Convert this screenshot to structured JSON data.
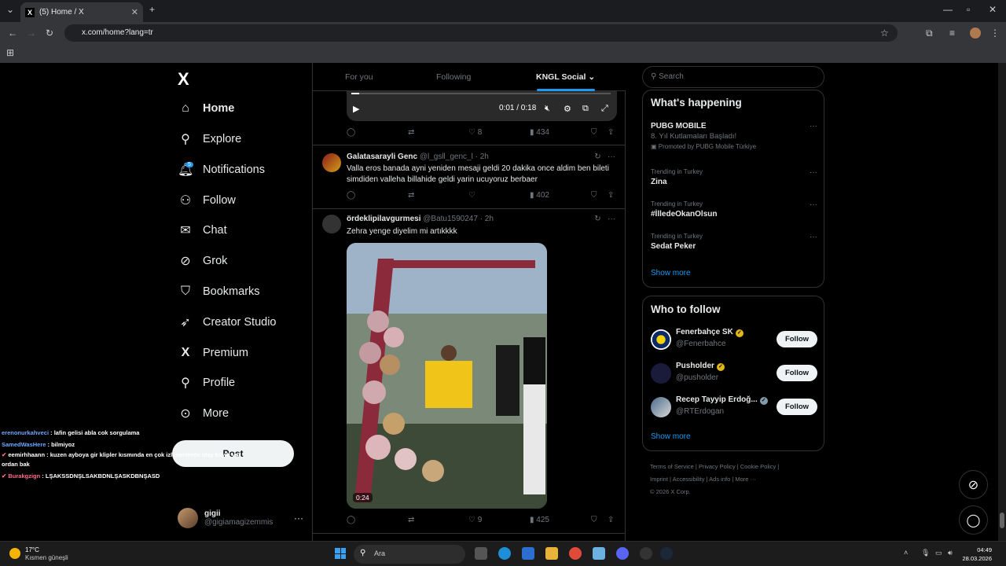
{
  "browser": {
    "tab_title": "(5) Home / X",
    "tab_favicon": "X",
    "url": "x.com/home?lang=tr"
  },
  "nav": {
    "logo": "X",
    "notifications_badge": "5",
    "items": [
      {
        "label": "Home",
        "icon": "home-icon"
      },
      {
        "label": "Explore",
        "icon": "search-icon"
      },
      {
        "label": "Notifications",
        "icon": "bell-icon"
      },
      {
        "label": "Follow",
        "icon": "person-add-icon"
      },
      {
        "label": "Chat",
        "icon": "mail-icon"
      },
      {
        "label": "Grok",
        "icon": "grok-icon"
      },
      {
        "label": "Bookmarks",
        "icon": "bookmark-icon"
      },
      {
        "label": "Creator Studio",
        "icon": "rocket-icon"
      },
      {
        "label": "Premium",
        "icon": "x-icon"
      },
      {
        "label": "Profile",
        "icon": "person-icon"
      },
      {
        "label": "More",
        "icon": "more-circle-icon"
      }
    ],
    "post_label": "Post",
    "account": {
      "name": "gigii",
      "handle": "@gigiamagizemmis"
    }
  },
  "chat_overlay": [
    {
      "user": "erenonurkahveci",
      "text": " : lafin gelisi abla cok sorgulama"
    },
    {
      "user": "SamedWasHere",
      "text": " : bilmiyoz"
    },
    {
      "user": "eemirhhaann",
      "text": " : kuzen ayboya gir klipler kısmında en çok izlenenlerde olay kayıtı var ordan bak"
    },
    {
      "user": "Burakgzign",
      "text": " : LŞAKSSDNŞLSAKBDNLŞASKDBNŞASD"
    }
  ],
  "feed": {
    "tabs": [
      "For you",
      "Following",
      "KNGL Social"
    ],
    "video_time": "0:01 / 0:18",
    "tweet0_actions": {
      "likes": "8",
      "views": "434"
    },
    "tweet1": {
      "name": "Galatasarayli Genc",
      "handle": "@l_gsll_genc_l",
      "time": "· 2h",
      "text": "Valla eros banada ayni yeniden mesaji geldi 20 dakika once aldim ben bileti simdiden valleha billahide geldi yarin ucuyoruz berbaer",
      "views": "402"
    },
    "tweet2": {
      "name": "ördeklipilavgurmesi",
      "handle": "@Batu1590247",
      "time": "· 2h",
      "text": "Zehra yenge diyelim mi artıkkkk",
      "duration": "0:24",
      "likes": "9",
      "views": "425"
    }
  },
  "right": {
    "search_placeholder": "Search",
    "happening_title": "What's happening",
    "trends": [
      {
        "meta": "",
        "title": "PUBG MOBILE",
        "sub": "8. Yıl Kutlamaları Başladı!",
        "promo": "Promoted by PUBG Mobile Türkiye"
      },
      {
        "meta": "Trending in Turkey",
        "title": "Zina"
      },
      {
        "meta": "Trending in Turkey",
        "title": "#İlledeOkanOlsun"
      },
      {
        "meta": "Trending in Turkey",
        "title": "Sedat Peker"
      }
    ],
    "show_more": "Show more",
    "who_title": "Who to follow",
    "who": [
      {
        "name": "Fenerbahçe SK",
        "handle": "@Fenerbahce",
        "btn": "Follow"
      },
      {
        "name": "Pusholder",
        "handle": "@pusholder",
        "btn": "Follow"
      },
      {
        "name": "Recep Tayyip Erdoğ...",
        "handle": "@RTErdogan",
        "btn": "Follow"
      }
    ],
    "footer_line1": "Terms of Service  |  Privacy Policy  |  Cookie Policy  |",
    "footer_line2": "Imprint  |  Accessibility  |  Ads info  |  More ···",
    "footer_line3": "© 2026 X Corp."
  },
  "taskbar": {
    "temp": "17°C",
    "weather": "Kısmen güneşli",
    "search": "Ara",
    "time": "04:49",
    "date": "28.03.2026"
  }
}
